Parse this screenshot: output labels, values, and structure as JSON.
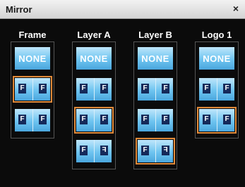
{
  "window": {
    "title": "Mirror",
    "close_label": "×"
  },
  "options": {
    "none_label": "NONE",
    "f_glyph": "F"
  },
  "columns": [
    {
      "name": "Frame",
      "items": [
        {
          "kind": "none",
          "selected": false
        },
        {
          "kind": "pair",
          "left": "normal",
          "right": "normal",
          "selected": true
        },
        {
          "kind": "pair",
          "left": "normal",
          "right": "normal",
          "selected": false
        }
      ]
    },
    {
      "name": "Layer A",
      "items": [
        {
          "kind": "none",
          "selected": false
        },
        {
          "kind": "pair",
          "left": "normal",
          "right": "normal",
          "selected": false
        },
        {
          "kind": "pair",
          "left": "normal",
          "right": "normal",
          "selected": true
        },
        {
          "kind": "pair",
          "left": "normal",
          "right": "mirror",
          "selected": false
        }
      ]
    },
    {
      "name": "Layer B",
      "items": [
        {
          "kind": "none",
          "selected": false
        },
        {
          "kind": "pair",
          "left": "normal",
          "right": "normal",
          "selected": false
        },
        {
          "kind": "pair",
          "left": "normal",
          "right": "normal",
          "selected": false
        },
        {
          "kind": "pair",
          "left": "normal",
          "right": "mirror",
          "selected": true
        }
      ]
    },
    {
      "name": "Logo 1",
      "items": [
        {
          "kind": "none",
          "selected": false
        },
        {
          "kind": "pair",
          "left": "normal",
          "right": "normal",
          "selected": false
        },
        {
          "kind": "pair",
          "left": "normal",
          "right": "normal",
          "selected": true
        }
      ]
    }
  ],
  "colors": {
    "accent": "#e08a3a",
    "tile": "#6ec4f0",
    "glyph_bg": "#152a5a",
    "background": "#0b0b0b"
  }
}
